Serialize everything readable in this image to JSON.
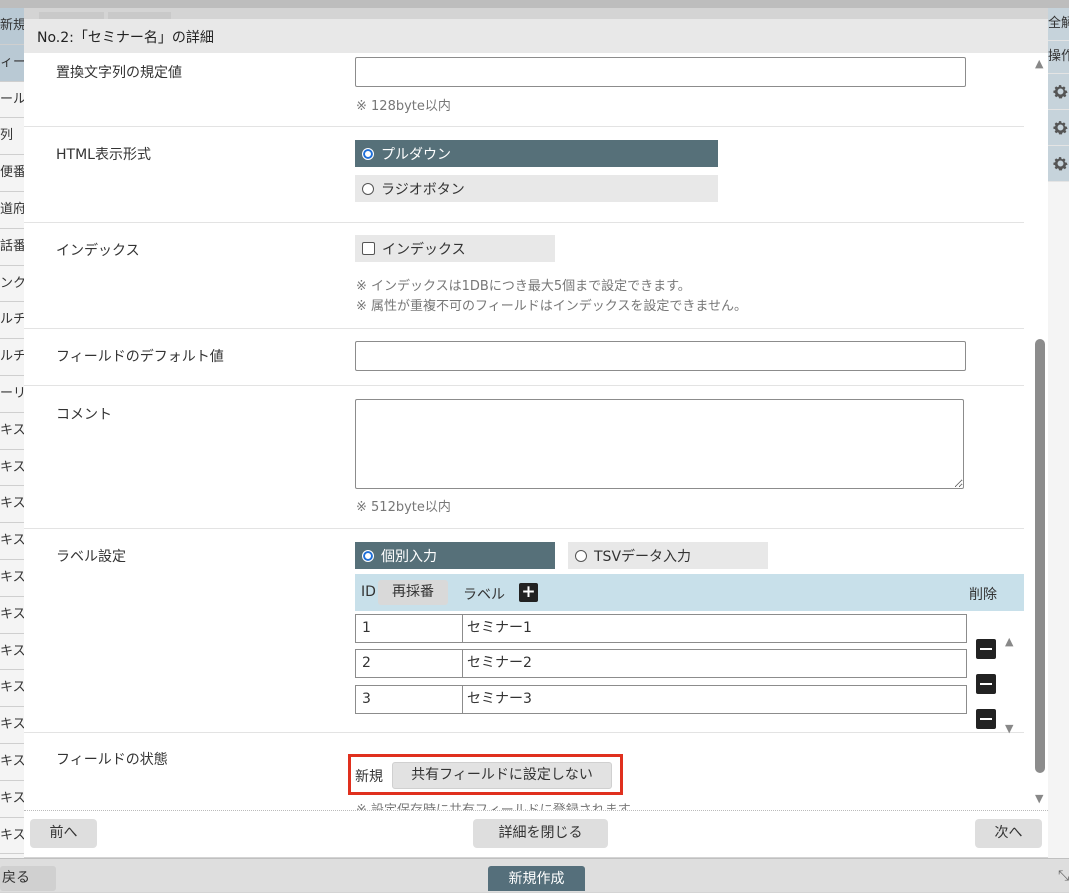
{
  "background": {
    "left_rows": [
      "新規",
      "ィー",
      "ール",
      "列",
      "便番",
      "道府",
      "話番",
      "ンク",
      "ルチ",
      "ルチ",
      "ーリ",
      "キス",
      "キス",
      "キス",
      "キス",
      "キス",
      "キス",
      "キス",
      "キス",
      "キス",
      "キス",
      "キス",
      "キス"
    ],
    "right_items": [
      "全解",
      "操作"
    ],
    "back_label": "戻る",
    "create_label": "新規作成"
  },
  "modal": {
    "title": "No.2:「セミナー名」の詳細",
    "replace_default": {
      "label": "置換文字列の規定値",
      "value": "",
      "note": "※ 128byte以内"
    },
    "html_format": {
      "label": "HTML表示形式",
      "options": [
        {
          "label": "プルダウン",
          "selected": true
        },
        {
          "label": "ラジオボタン",
          "selected": false
        }
      ]
    },
    "index": {
      "label": "インデックス",
      "checkbox_label": "インデックス",
      "checked": false,
      "notes": [
        "※ インデックスは1DBにつき最大5個まで設定できます。",
        "※ 属性が重複不可のフィールドはインデックスを設定できません。"
      ]
    },
    "default_value": {
      "label": "フィールドのデフォルト値",
      "value": ""
    },
    "comment": {
      "label": "コメント",
      "value": "",
      "note": "※ 512byte以内"
    },
    "label_setting": {
      "label": "ラベル設定",
      "modes": [
        {
          "label": "個別入力",
          "selected": true
        },
        {
          "label": "TSVデータ入力",
          "selected": false
        }
      ],
      "headers": {
        "id": "ID",
        "renumber": "再採番",
        "label": "ラベル",
        "delete": "削除"
      },
      "rows": [
        {
          "id": "1",
          "label": "セミナー1"
        },
        {
          "id": "2",
          "label": "セミナー2"
        },
        {
          "id": "3",
          "label": "セミナー3"
        }
      ]
    },
    "field_status": {
      "label": "フィールドの状態",
      "state": "新規",
      "button": "共有フィールドに設定しない",
      "note": "※ 設定保存時に共有フィールドに登録されます。"
    },
    "footer": {
      "prev": "前へ",
      "close": "詳細を閉じる",
      "next": "次へ"
    }
  },
  "colors": {
    "selected_option": "#567079",
    "highlight_border": "#e0301e",
    "table_header": "#c8e0ea"
  }
}
